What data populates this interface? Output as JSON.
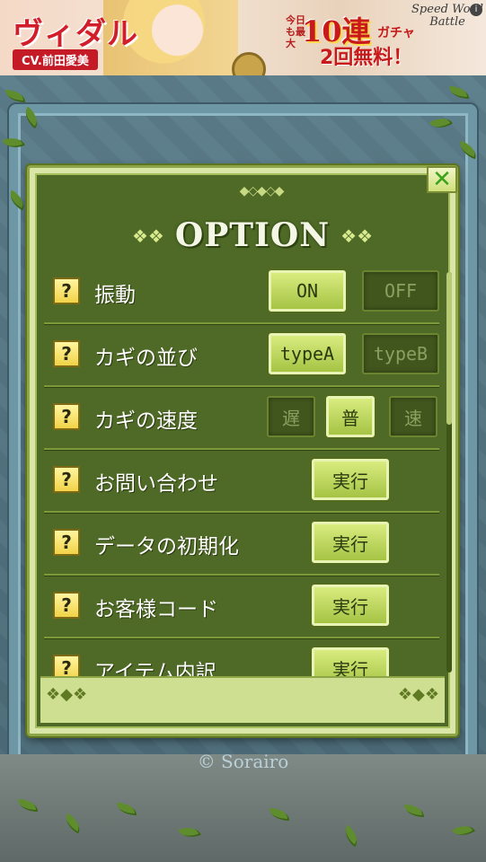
{
  "banner": {
    "character_name": "ヴィダル",
    "cv_label": "CV.前田愛美",
    "promo_small": "今日も最大",
    "promo_big": "10連",
    "promo_gacha": "ガチャ",
    "promo_line2": "2回無料！",
    "logo_text": "Speed Word Battle",
    "info_icon": "i"
  },
  "dialog": {
    "title": "OPTION",
    "close_symbol": "✕",
    "help_symbol": "?",
    "options": [
      {
        "label": "振動",
        "buttons": [
          {
            "label": "ON",
            "state": "selected"
          },
          {
            "label": "OFF",
            "state": "unselected"
          }
        ]
      },
      {
        "label": "カギの並び",
        "buttons": [
          {
            "label": "typeA",
            "state": "selected"
          },
          {
            "label": "typeB",
            "state": "unselected"
          }
        ]
      },
      {
        "label": "カギの速度",
        "buttons": [
          {
            "label": "遅",
            "state": "unselected"
          },
          {
            "label": "普",
            "state": "selected"
          },
          {
            "label": "速",
            "state": "unselected"
          }
        ]
      },
      {
        "label": "お問い合わせ",
        "buttons": [
          {
            "label": "実行",
            "state": "action"
          }
        ]
      },
      {
        "label": "データの初期化",
        "buttons": [
          {
            "label": "実行",
            "state": "action"
          }
        ]
      },
      {
        "label": "お客様コード",
        "buttons": [
          {
            "label": "実行",
            "state": "action"
          }
        ]
      },
      {
        "label": "アイテム内訳",
        "buttons": [
          {
            "label": "実行",
            "state": "action"
          }
        ]
      }
    ]
  },
  "footer": {
    "copyright": "© Sorairo"
  },
  "colors": {
    "panel": "#4e6a26",
    "frame": "#d9e6a8",
    "button_active": "#b8d15a",
    "button_inactive": "#41561d",
    "help_icon": "#f1d348"
  },
  "icons": {
    "close": "close-icon",
    "help": "help-icon"
  }
}
